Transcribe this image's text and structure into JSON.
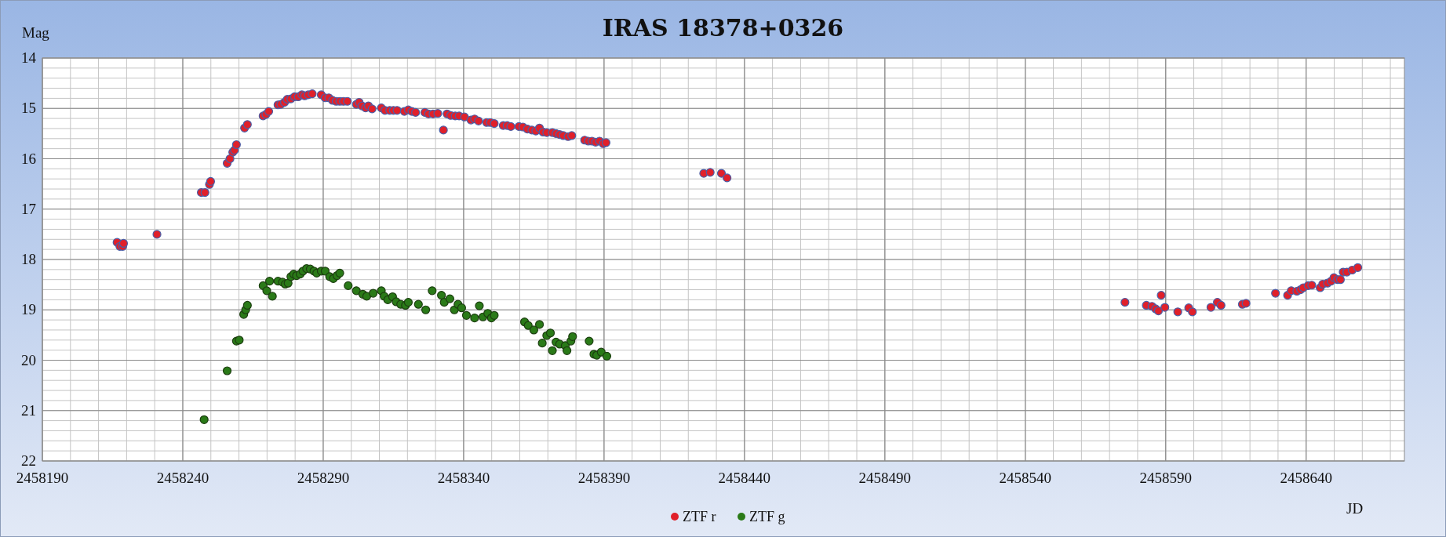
{
  "chart_data": {
    "type": "scatter",
    "title": "IRAS 18378+0326",
    "xlabel": "JD",
    "ylabel": "Mag",
    "xlim": [
      2458190,
      2458675
    ],
    "ylim": [
      22,
      14
    ],
    "xticks": [
      2458190,
      2458240,
      2458290,
      2458340,
      2458390,
      2458440,
      2458490,
      2458540,
      2458590,
      2458640
    ],
    "yticks": [
      14,
      15,
      16,
      17,
      18,
      19,
      20,
      21,
      22
    ],
    "grid": true,
    "legend": true,
    "series": [
      {
        "name": "ZTF r",
        "color": "#e0202a",
        "x": [
          2458216.6,
          2458217.6,
          2458218.6,
          2458218.9,
          2458230.8,
          2458246.6,
          2458247.9,
          2458249.5,
          2458249.9,
          2458255.8,
          2458256.8,
          2458257.8,
          2458258.4,
          2458259.1,
          2458262.0,
          2458263.0,
          2458268.6,
          2458269.6,
          2458270.6,
          2458273.9,
          2458274.9,
          2458276.2,
          2458277.2,
          2458278.5,
          2458279.8,
          2458281.1,
          2458282.4,
          2458283.4,
          2458284.7,
          2458286.1,
          2458289.3,
          2458290.7,
          2458292.0,
          2458293.3,
          2458294.6,
          2458295.9,
          2458297.2,
          2458298.6,
          2458301.8,
          2458302.8,
          2458303.8,
          2458305.1,
          2458306.1,
          2458307.4,
          2458310.7,
          2458312.0,
          2458313.7,
          2458315.0,
          2458316.3,
          2458318.9,
          2458320.3,
          2458321.6,
          2458322.9,
          2458326.2,
          2458327.5,
          2458329.1,
          2458330.8,
          2458332.8,
          2458334.1,
          2458335.4,
          2458337.0,
          2458338.4,
          2458340.3,
          2458342.6,
          2458343.9,
          2458345.3,
          2458348.2,
          2458349.5,
          2458350.9,
          2458354.1,
          2458355.5,
          2458356.8,
          2458359.7,
          2458361.1,
          2458362.7,
          2458364.3,
          2458365.7,
          2458367.0,
          2458368.3,
          2458369.6,
          2458371.6,
          2458372.9,
          2458374.2,
          2458375.5,
          2458377.2,
          2458378.5,
          2458383.1,
          2458384.4,
          2458385.7,
          2458387.0,
          2458388.4,
          2458389.7,
          2458390.7,
          2458425.5,
          2458427.8,
          2458431.8,
          2458433.8,
          2458575.5,
          2458583.1,
          2458585.1,
          2458586.4,
          2458587.4,
          2458588.4,
          2458589.7,
          2458594.3,
          2458598.2,
          2458599.5,
          2458606.1,
          2458608.4,
          2458609.7,
          2458617.3,
          2458618.6,
          2458629.1,
          2458633.4,
          2458634.7,
          2458636.7,
          2458638.0,
          2458639.0,
          2458640.7,
          2458642.0,
          2458645.0,
          2458645.9,
          2458647.6,
          2458648.9,
          2458649.9,
          2458651.2,
          2458652.2,
          2458653.2,
          2458654.5,
          2458656.4,
          2458658.4
        ],
        "values": [
          17.66,
          17.74,
          17.74,
          17.68,
          17.5,
          16.67,
          16.67,
          16.51,
          16.45,
          16.09,
          16.0,
          15.87,
          15.83,
          15.72,
          15.39,
          15.32,
          15.15,
          15.12,
          15.06,
          14.93,
          14.92,
          14.88,
          14.82,
          14.81,
          14.77,
          14.77,
          14.73,
          14.75,
          14.73,
          14.71,
          14.73,
          14.79,
          14.79,
          14.84,
          14.86,
          14.86,
          14.86,
          14.86,
          14.92,
          14.88,
          14.95,
          14.99,
          14.95,
          15.01,
          14.99,
          15.04,
          15.04,
          15.04,
          15.04,
          15.06,
          15.03,
          15.06,
          15.08,
          15.08,
          15.11,
          15.11,
          15.1,
          15.43,
          15.11,
          15.14,
          15.15,
          15.15,
          15.17,
          15.23,
          15.21,
          15.25,
          15.28,
          15.28,
          15.3,
          15.34,
          15.34,
          15.36,
          15.36,
          15.37,
          15.41,
          15.43,
          15.45,
          15.39,
          15.47,
          15.48,
          15.48,
          15.5,
          15.52,
          15.54,
          15.56,
          15.54,
          15.63,
          15.65,
          15.65,
          15.67,
          15.65,
          15.7,
          15.68,
          16.29,
          16.27,
          16.29,
          16.38,
          18.85,
          18.91,
          18.93,
          18.98,
          19.02,
          18.71,
          18.95,
          19.04,
          18.96,
          19.04,
          18.95,
          18.85,
          18.91,
          18.89,
          18.87,
          18.67,
          18.71,
          18.62,
          18.63,
          18.6,
          18.56,
          18.52,
          18.51,
          18.56,
          18.49,
          18.47,
          18.43,
          18.36,
          18.4,
          18.4,
          18.25,
          18.25,
          18.21,
          18.16
        ]
      },
      {
        "name": "ZTF g",
        "color": "#2a7a18",
        "x": [
          2458247.6,
          2458255.8,
          2458259.1,
          2458260.1,
          2458261.7,
          2458262.4,
          2458263.0,
          2458268.6,
          2458269.9,
          2458270.9,
          2458271.9,
          2458273.9,
          2458275.5,
          2458276.5,
          2458277.5,
          2458278.5,
          2458279.5,
          2458280.5,
          2458281.8,
          2458282.8,
          2458284.1,
          2458285.4,
          2458286.7,
          2458287.7,
          2458289.3,
          2458290.7,
          2458292.3,
          2458293.6,
          2458294.9,
          2458295.9,
          2458298.9,
          2458301.8,
          2458304.1,
          2458305.5,
          2458307.8,
          2458310.7,
          2458311.7,
          2458313.0,
          2458314.7,
          2458316.0,
          2458317.6,
          2458319.3,
          2458320.3,
          2458323.9,
          2458326.5,
          2458328.8,
          2458332.1,
          2458333.1,
          2458335.1,
          2458336.7,
          2458338.0,
          2458339.3,
          2458341.0,
          2458343.9,
          2458345.6,
          2458346.9,
          2458348.6,
          2458349.9,
          2458350.9,
          2458361.7,
          2458363.0,
          2458365.0,
          2458367.0,
          2458368.0,
          2458369.6,
          2458370.9,
          2458371.6,
          2458372.9,
          2458374.2,
          2458376.2,
          2458376.8,
          2458378.2,
          2458378.8,
          2458384.7,
          2458386.4,
          2458387.4,
          2458389.0,
          2458391.0
        ],
        "values": [
          21.18,
          20.21,
          19.62,
          19.6,
          19.09,
          19.0,
          18.91,
          18.52,
          18.62,
          18.43,
          18.73,
          18.43,
          18.45,
          18.49,
          18.47,
          18.34,
          18.29,
          18.32,
          18.29,
          18.23,
          18.18,
          18.19,
          18.23,
          18.27,
          18.23,
          18.23,
          18.34,
          18.38,
          18.32,
          18.27,
          18.52,
          18.62,
          18.69,
          18.73,
          18.67,
          18.62,
          18.73,
          18.8,
          18.74,
          18.84,
          18.89,
          18.91,
          18.85,
          18.89,
          19.0,
          18.62,
          18.71,
          18.85,
          18.78,
          19.0,
          18.89,
          18.96,
          19.11,
          19.16,
          18.92,
          19.14,
          19.07,
          19.16,
          19.11,
          19.24,
          19.31,
          19.4,
          19.29,
          19.66,
          19.51,
          19.46,
          19.81,
          19.64,
          19.68,
          19.71,
          19.81,
          19.62,
          19.53,
          19.62,
          19.88,
          19.9,
          19.84,
          19.92
        ]
      }
    ]
  }
}
